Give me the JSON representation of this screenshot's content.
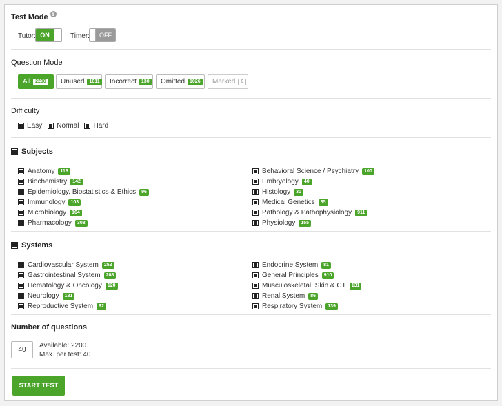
{
  "test_mode": {
    "title": "Test Mode",
    "info_icon": "info-icon",
    "tutor_label": "Tutor:",
    "tutor_state": "ON",
    "timer_label": "Timer:",
    "timer_state": "OFF"
  },
  "question_mode": {
    "title": "Question Mode",
    "buttons": [
      {
        "label": "All",
        "count": "2200"
      },
      {
        "label": "Unused",
        "count": "1011"
      },
      {
        "label": "Incorrect",
        "count": "130"
      },
      {
        "label": "Omitted",
        "count": "1026"
      },
      {
        "label": "Marked",
        "count": "0"
      }
    ]
  },
  "difficulty": {
    "title": "Difficulty",
    "options": [
      "Easy",
      "Normal",
      "Hard"
    ]
  },
  "subjects": {
    "title": "Subjects",
    "left": [
      {
        "label": "Anatomy",
        "count": "116"
      },
      {
        "label": "Biochemistry",
        "count": "142"
      },
      {
        "label": "Epidemiology, Biostatistics & Ethics",
        "count": "96"
      },
      {
        "label": "Immunology",
        "count": "103"
      },
      {
        "label": "Microbiology",
        "count": "164"
      },
      {
        "label": "Pharmacology",
        "count": "308"
      }
    ],
    "right": [
      {
        "label": "Behavioral Science / Psychiatry",
        "count": "100"
      },
      {
        "label": "Embryology",
        "count": "40"
      },
      {
        "label": "Histology",
        "count": "30"
      },
      {
        "label": "Medical Genetics",
        "count": "35"
      },
      {
        "label": "Pathology & Pathophysiology",
        "count": "911"
      },
      {
        "label": "Physiology",
        "count": "155"
      }
    ]
  },
  "systems": {
    "title": "Systems",
    "left": [
      {
        "label": "Cardiovascular System",
        "count": "252"
      },
      {
        "label": "Gastrointestinal System",
        "count": "208"
      },
      {
        "label": "Hematology & Oncology",
        "count": "120"
      },
      {
        "label": "Neurology",
        "count": "181"
      },
      {
        "label": "Reproductive System",
        "count": "92"
      }
    ],
    "right": [
      {
        "label": "Endocrine System",
        "count": "81"
      },
      {
        "label": "General Principles",
        "count": "910"
      },
      {
        "label": "Musculoskeletal, Skin & CT",
        "count": "131"
      },
      {
        "label": "Renal System",
        "count": "86"
      },
      {
        "label": "Respiratory System",
        "count": "139"
      }
    ]
  },
  "number_of_questions": {
    "title": "Number of questions",
    "value": "40",
    "available": "Available: 2200",
    "max_per_test": "Max. per test: 40"
  },
  "start_button": "START TEST",
  "colors": {
    "accent": "#4ba52a",
    "toggle_off": "#9a9a9a"
  }
}
